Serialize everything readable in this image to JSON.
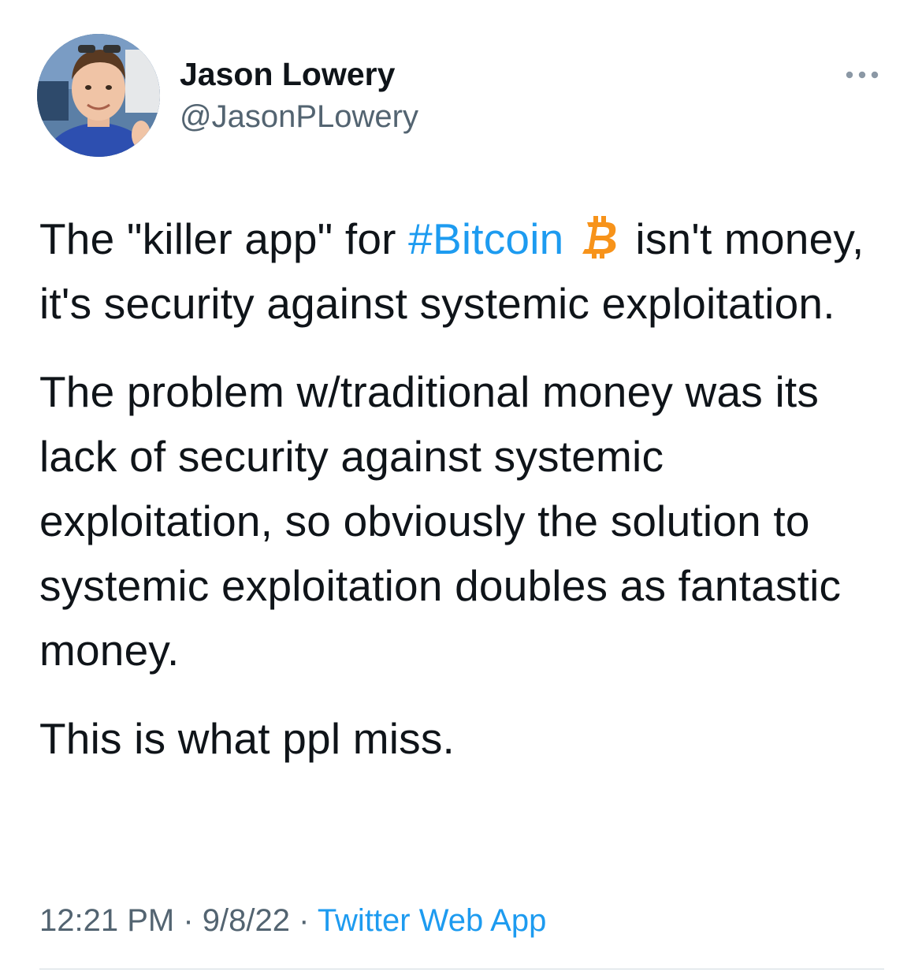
{
  "author": {
    "name": "Jason Lowery",
    "handle": "@JasonPLowery"
  },
  "tweet": {
    "paragraph1": {
      "before": "The \"killer app\" for ",
      "hashtag": "#Bitcoin",
      "emoji": "bitcoin-icon",
      "after": " isn't money, it's security against systemic exploitation."
    },
    "paragraph2": "The problem w/traditional money was its lack of security against systemic exploitation, so obviously the solution to systemic exploitation doubles as fantastic money.",
    "paragraph3": "This is what ppl miss."
  },
  "meta": {
    "time": "12:21 PM",
    "separator": " · ",
    "date": "9/8/22",
    "source": "Twitter Web App"
  },
  "colors": {
    "link": "#1d9bf0",
    "secondary_text": "#536471",
    "bitcoin_orange": "#f7931a"
  },
  "icons": {
    "more": "more-icon",
    "avatar": "avatar"
  }
}
